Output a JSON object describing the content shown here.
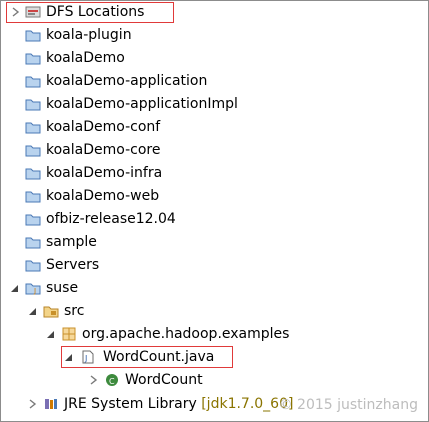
{
  "tree": {
    "dfs_locations": "DFS Locations",
    "projects": [
      "koala-plugin",
      "koalaDemo",
      "koalaDemo-application",
      "koalaDemo-applicationImpl",
      "koalaDemo-conf",
      "koalaDemo-core",
      "koalaDemo-infra",
      "koalaDemo-web",
      "ofbiz-release12.04",
      "sample",
      "Servers"
    ],
    "suse": "suse",
    "src": "src",
    "package": "org.apache.hadoop.examples",
    "java_file": "WordCount.java",
    "class_name": "WordCount",
    "jre_label": "JRE System Library",
    "jre_version": "[jdk1.7.0_60]"
  },
  "watermark": "© 2015 justinzhang",
  "colors": {
    "folder": "#7aa6d8",
    "highlight_border": "#e03a3a",
    "package": "#c8902a",
    "class_icon": "#3d8a3d",
    "decorator": "#8a7400"
  },
  "icons": {
    "dfs": "dfs-location-icon",
    "project": "folder-project-icon",
    "src": "source-folder-icon",
    "package": "package-icon",
    "java": "java-file-icon",
    "class": "class-icon",
    "jre": "library-icon"
  }
}
